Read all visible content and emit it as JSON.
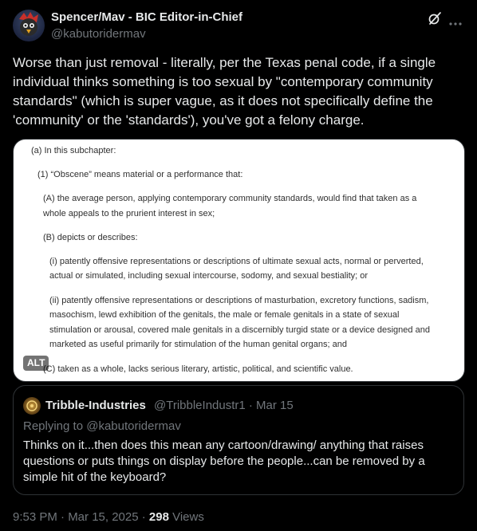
{
  "author": {
    "name": "Spencer/Mav - BIC Editor-in-Chief",
    "handle": "@kabutoridermav"
  },
  "tweet": {
    "lines": [
      "Worse than just removal - literally, per the Texas penal code, if a single",
      "individual thinks something is too sexual by \"contemporary community",
      "standards\" (which is super vague, as it does not specifically define the",
      "'community' or the 'standards'), you've got a felony charge."
    ]
  },
  "media": {
    "alt_label": "ALT",
    "lines": {
      "a": "(a) In this subchapter:",
      "one": "(1) “Obscene” means material or a performance that:",
      "A1": "(A) the average person, applying contemporary community standards, would find that taken as a",
      "A2": "whole appeals to the prurient interest in sex;",
      "B": "(B) depicts or describes:",
      "i1": "(i) patently offensive representations or descriptions of ultimate sexual acts, normal or perverted,",
      "i2": "actual or simulated, including sexual intercourse, sodomy, and sexual bestiality; or",
      "ii1": "(ii) patently offensive representations or descriptions of masturbation, excretory functions, sadism,",
      "ii2": "masochism, lewd exhibition of the genitals, the male or female genitals in a state of sexual",
      "ii3": "stimulation or arousal, covered male genitals in a discernibly turgid state or a device designed and",
      "ii4": "marketed as useful primarily for stimulation of the human genital organs; and",
      "C": "(C) taken as a whole, lacks serious literary, artistic, political, and scientific value."
    }
  },
  "quote": {
    "name": "Tribble-Industries",
    "meta": "@TribbleIndustr1 · Mar 15",
    "reply": "Replying to @kabutoridermav",
    "lines": [
      "Thinks on it...then does this mean any cartoon/drawing/ anything that raises",
      "questions or puts things on display before the people...can be removed by a",
      "simple hit of the keyboard?"
    ]
  },
  "footer": {
    "time": "9:53 PM · Mar 15, 2025 · ",
    "views": "298",
    "views_label": " Views"
  },
  "icons": {
    "grok": "grok-icon",
    "more": "more-icon"
  }
}
